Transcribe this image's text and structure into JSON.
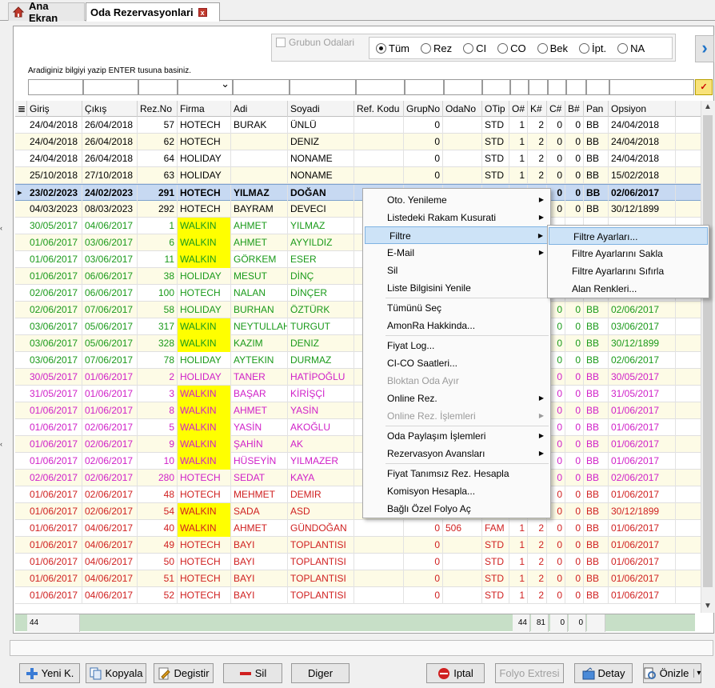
{
  "tabs": {
    "home_label": "Ana Ekran",
    "reservations_label": "Oda Rezervasyonlari",
    "close_glyph": "x"
  },
  "filter": {
    "group_rooms_label": "Grubun Odalari",
    "radios": [
      {
        "label": "Tüm",
        "selected": true
      },
      {
        "label": "Rez",
        "selected": false
      },
      {
        "label": "CI",
        "selected": false
      },
      {
        "label": "CO",
        "selected": false
      },
      {
        "label": "Bek",
        "selected": false
      },
      {
        "label": "İpt.",
        "selected": false
      },
      {
        "label": "NA",
        "selected": false
      }
    ],
    "search_hint": "Aradiginiz bilgiyi yazip ENTER tusuna basiniz.",
    "next_glyph": "›"
  },
  "grid": {
    "columns": [
      "Giriş",
      "Çıkış",
      "Rez.No",
      "Firma",
      "Adi",
      "Soyadi",
      "Ref. Kodu",
      "GrupNo",
      "OdaNo",
      "OTip",
      "O#",
      "K#",
      "C#",
      "B#",
      "Pan",
      "Opsiyon"
    ],
    "rows": [
      {
        "c": [
          "24/04/2018",
          "26/04/2018",
          "57",
          "HOTECH",
          "BURAK",
          "ÜNLÜ",
          "",
          "0",
          "",
          "STD",
          "1",
          "2",
          "0",
          "0",
          "BB",
          "24/04/2018"
        ],
        "color": "#000000",
        "bg": "#ffffff"
      },
      {
        "c": [
          "24/04/2018",
          "26/04/2018",
          "62",
          "HOTECH",
          "",
          "DENIZ",
          "",
          "0",
          "",
          "STD",
          "1",
          "2",
          "0",
          "0",
          "BB",
          "24/04/2018"
        ],
        "color": "#000000",
        "bg": "#fdfbe6"
      },
      {
        "c": [
          "24/04/2018",
          "26/04/2018",
          "64",
          "HOLIDAY",
          "",
          "NONAME",
          "",
          "0",
          "",
          "STD",
          "1",
          "2",
          "0",
          "0",
          "BB",
          "24/04/2018"
        ],
        "color": "#000000",
        "bg": "#ffffff"
      },
      {
        "c": [
          "25/10/2018",
          "27/10/2018",
          "63",
          "HOLIDAY",
          "",
          "NONAME",
          "",
          "0",
          "",
          "STD",
          "1",
          "2",
          "0",
          "0",
          "BB",
          "15/02/2018"
        ],
        "color": "#000000",
        "bg": "#fdfbe6"
      },
      {
        "c": [
          "23/02/2023",
          "24/02/2023",
          "291",
          "HOTECH",
          "YILMAZ",
          "DOĞAN",
          "",
          "",
          "",
          "",
          "",
          "",
          "0",
          "0",
          "BB",
          "02/06/2017"
        ],
        "color": "#000000",
        "bg": "#c7d9f2",
        "selected": true
      },
      {
        "c": [
          "04/03/2023",
          "08/03/2023",
          "292",
          "HOTECH",
          "BAYRAM",
          "DEVECI",
          "",
          "",
          "",
          "",
          "",
          "",
          "0",
          "0",
          "BB",
          "30/12/1899"
        ],
        "color": "#000000",
        "bg": "#fdfbe6"
      },
      {
        "c": [
          "30/05/2017",
          "04/06/2017",
          "1",
          "WALKIN",
          "AHMET",
          "YILMAZ",
          "",
          "",
          "",
          "",
          "",
          "",
          "",
          "",
          "",
          ""
        ],
        "color": "#1a9a1a",
        "bg": "#ffffff",
        "walkin": true
      },
      {
        "c": [
          "01/06/2017",
          "03/06/2017",
          "6",
          "WALKIN",
          "AHMET",
          "AYYILDIZ",
          "",
          "",
          "",
          "",
          "",
          "",
          "",
          "",
          "",
          ""
        ],
        "color": "#1a9a1a",
        "bg": "#fdfbe6",
        "walkin": true
      },
      {
        "c": [
          "01/06/2017",
          "03/06/2017",
          "11",
          "WALKIN",
          "GÖRKEM",
          "ESER",
          "",
          "",
          "",
          "",
          "",
          "",
          "",
          "",
          "",
          ""
        ],
        "color": "#1a9a1a",
        "bg": "#ffffff",
        "walkin": true
      },
      {
        "c": [
          "01/06/2017",
          "06/06/2017",
          "38",
          "HOLIDAY",
          "MESUT",
          "DİNÇ",
          "",
          "",
          "",
          "",
          "",
          "",
          "",
          "",
          "",
          ""
        ],
        "color": "#1a9a1a",
        "bg": "#fdfbe6"
      },
      {
        "c": [
          "02/06/2017",
          "06/06/2017",
          "100",
          "HOTECH",
          "NALAN",
          "DİNÇER",
          "",
          "",
          "",
          "",
          "",
          "",
          "",
          "",
          "",
          ""
        ],
        "color": "#1a9a1a",
        "bg": "#ffffff"
      },
      {
        "c": [
          "02/06/2017",
          "07/06/2017",
          "58",
          "HOLIDAY",
          "BURHAN",
          "ÖZTÜRK",
          "",
          "",
          "",
          "",
          "",
          "",
          "0",
          "0",
          "BB",
          "02/06/2017"
        ],
        "color": "#1a9a1a",
        "bg": "#fdfbe6"
      },
      {
        "c": [
          "03/06/2017",
          "05/06/2017",
          "317",
          "WALKIN",
          "NEYTULLAH",
          "TURGUT",
          "",
          "",
          "",
          "",
          "",
          "",
          "0",
          "0",
          "BB",
          "03/06/2017"
        ],
        "color": "#1a9a1a",
        "bg": "#ffffff",
        "walkin": true
      },
      {
        "c": [
          "03/06/2017",
          "05/06/2017",
          "328",
          "WALKIN",
          "KAZIM",
          "DENIZ",
          "",
          "",
          "",
          "",
          "",
          "",
          "0",
          "0",
          "BB",
          "30/12/1899"
        ],
        "color": "#1a9a1a",
        "bg": "#fdfbe6",
        "walkin": true
      },
      {
        "c": [
          "03/06/2017",
          "07/06/2017",
          "78",
          "HOLIDAY",
          "AYTEKIN",
          "DURMAZ",
          "",
          "",
          "",
          "",
          "",
          "",
          "0",
          "0",
          "BB",
          "02/06/2017"
        ],
        "color": "#1a9a1a",
        "bg": "#ffffff"
      },
      {
        "c": [
          "30/05/2017",
          "01/06/2017",
          "2",
          "HOLIDAY",
          "TANER",
          "HATİPOĞLU",
          "",
          "",
          "",
          "",
          "",
          "",
          "0",
          "0",
          "BB",
          "30/05/2017"
        ],
        "color": "#d020c8",
        "bg": "#fdfbe6"
      },
      {
        "c": [
          "31/05/2017",
          "01/06/2017",
          "3",
          "WALKIN",
          "BAŞAR",
          "KİRİŞÇİ",
          "",
          "",
          "",
          "",
          "",
          "",
          "0",
          "0",
          "BB",
          "31/05/2017"
        ],
        "color": "#d020c8",
        "bg": "#ffffff",
        "walkin": true
      },
      {
        "c": [
          "01/06/2017",
          "01/06/2017",
          "8",
          "WALKIN",
          "AHMET",
          "YASİN",
          "",
          "",
          "",
          "",
          "",
          "",
          "0",
          "0",
          "BB",
          "01/06/2017"
        ],
        "color": "#d020c8",
        "bg": "#fdfbe6",
        "walkin": true
      },
      {
        "c": [
          "01/06/2017",
          "02/06/2017",
          "5",
          "WALKIN",
          "YASİN",
          "AKOĞLU",
          "",
          "",
          "",
          "",
          "",
          "",
          "0",
          "0",
          "BB",
          "01/06/2017"
        ],
        "color": "#d020c8",
        "bg": "#ffffff",
        "walkin": true
      },
      {
        "c": [
          "01/06/2017",
          "02/06/2017",
          "9",
          "WALKIN",
          "ŞAHİN",
          "AK",
          "",
          "",
          "",
          "",
          "",
          "",
          "0",
          "0",
          "BB",
          "01/06/2017"
        ],
        "color": "#d020c8",
        "bg": "#fdfbe6",
        "walkin": true
      },
      {
        "c": [
          "01/06/2017",
          "02/06/2017",
          "10",
          "WALKIN",
          "HÜSEYİN",
          "YILMAZER",
          "",
          "",
          "",
          "",
          "",
          "",
          "0",
          "0",
          "BB",
          "01/06/2017"
        ],
        "color": "#d020c8",
        "bg": "#ffffff",
        "walkin": true
      },
      {
        "c": [
          "02/06/2017",
          "02/06/2017",
          "280",
          "HOTECH",
          "SEDAT",
          "KAYA",
          "",
          "",
          "",
          "",
          "",
          "",
          "0",
          "0",
          "BB",
          "02/06/2017"
        ],
        "color": "#d020c8",
        "bg": "#fdfbe6"
      },
      {
        "c": [
          "01/06/2017",
          "02/06/2017",
          "48",
          "HOTECH",
          "MEHMET",
          "DEMIR",
          "",
          "",
          "",
          "",
          "",
          "",
          "0",
          "0",
          "BB",
          "01/06/2017"
        ],
        "color": "#d02020",
        "bg": "#ffffff"
      },
      {
        "c": [
          "01/06/2017",
          "02/06/2017",
          "54",
          "WALKIN",
          "SADA",
          "ASD",
          "",
          "",
          "",
          "",
          "",
          "",
          "0",
          "0",
          "BB",
          "30/12/1899"
        ],
        "color": "#d02020",
        "bg": "#fdfbe6",
        "walkin": true
      },
      {
        "c": [
          "01/06/2017",
          "04/06/2017",
          "40",
          "WALKIN",
          "AHMET",
          "GÜNDOĞAN",
          "",
          "0",
          "506",
          "FAM",
          "1",
          "2",
          "0",
          "0",
          "BB",
          "01/06/2017"
        ],
        "color": "#d02020",
        "bg": "#ffffff",
        "walkin": true
      },
      {
        "c": [
          "01/06/2017",
          "04/06/2017",
          "49",
          "HOTECH",
          "BAYI",
          "TOPLANTISI",
          "",
          "0",
          "",
          "STD",
          "1",
          "2",
          "0",
          "0",
          "BB",
          "01/06/2017"
        ],
        "color": "#d02020",
        "bg": "#fdfbe6"
      },
      {
        "c": [
          "01/06/2017",
          "04/06/2017",
          "50",
          "HOTECH",
          "BAYI",
          "TOPLANTISI",
          "",
          "0",
          "",
          "STD",
          "1",
          "2",
          "0",
          "0",
          "BB",
          "01/06/2017"
        ],
        "color": "#d02020",
        "bg": "#ffffff"
      },
      {
        "c": [
          "01/06/2017",
          "04/06/2017",
          "51",
          "HOTECH",
          "BAYI",
          "TOPLANTISI",
          "",
          "0",
          "",
          "STD",
          "1",
          "2",
          "0",
          "0",
          "BB",
          "01/06/2017"
        ],
        "color": "#d02020",
        "bg": "#fdfbe6"
      },
      {
        "c": [
          "01/06/2017",
          "04/06/2017",
          "52",
          "HOTECH",
          "BAYI",
          "TOPLANTISI",
          "",
          "0",
          "",
          "STD",
          "1",
          "2",
          "0",
          "0",
          "BB",
          "01/06/2017"
        ],
        "color": "#d02020",
        "bg": "#ffffff"
      }
    ],
    "footer": {
      "count": "44",
      "o_total": "44",
      "k_total": "81",
      "c_total": "0",
      "b_total": "0"
    }
  },
  "context_menu": {
    "items": [
      {
        "label": "Oto. Yenileme",
        "sub": true
      },
      {
        "label": "Listedeki Rakam Kusurati",
        "sub": true
      },
      {
        "label": "Filtre",
        "sub": true,
        "highlighted": true
      },
      {
        "label": "E-Mail",
        "sub": true
      },
      {
        "label": "Sil"
      },
      {
        "label": "Liste Bilgisini Yenile",
        "sep_after": true
      },
      {
        "label": "Tümünü Seç"
      },
      {
        "label": "AmonRa Hakkinda...",
        "sep_after": true
      },
      {
        "label": "Fiyat Log..."
      },
      {
        "label": "CI-CO Saatleri..."
      },
      {
        "label": "Bloktan Oda Ayır",
        "disabled": true
      },
      {
        "label": "Online Rez.",
        "sub": true
      },
      {
        "label": "Online Rez. İşlemleri",
        "sub": true,
        "disabled": true,
        "sep_after": true
      },
      {
        "label": "Oda Paylaşım İşlemleri",
        "sub": true
      },
      {
        "label": "Rezervasyon Avansları",
        "sub": true,
        "sep_after": true
      },
      {
        "label": "Fiyat Tanımsız Rez. Hesapla"
      },
      {
        "label": "Komisyon Hesapla..."
      },
      {
        "label": "Bağlı Özel Folyo Aç"
      }
    ],
    "submenu": [
      {
        "label": "Filtre Ayarları...",
        "highlighted": true
      },
      {
        "label": "Filtre Ayarlarını Sakla"
      },
      {
        "label": "Filtre Ayarlarını Sıfırla"
      },
      {
        "label": "Alan Renkleri..."
      }
    ]
  },
  "buttons": [
    {
      "label": "Yeni K.",
      "icon": "plus-icon"
    },
    {
      "label": "Kopyala",
      "icon": "copy-icon"
    },
    {
      "label": "Degistir",
      "icon": "edit-icon"
    },
    {
      "label": "Sil",
      "icon": "minus-icon"
    },
    {
      "label": "Diger",
      "icon": ""
    },
    {
      "label": "Iptal",
      "icon": "cancel-icon"
    },
    {
      "label": "Folyo Extresi",
      "icon": "",
      "disabled": true
    },
    {
      "label": "Detay",
      "icon": "detail-icon"
    },
    {
      "label": "Önizle",
      "icon": "preview-icon"
    }
  ],
  "colors": {
    "walkin_bg": "#ffff00",
    "selected_row": "#c7d9f2",
    "menu_highlight": "#cde3f7"
  }
}
